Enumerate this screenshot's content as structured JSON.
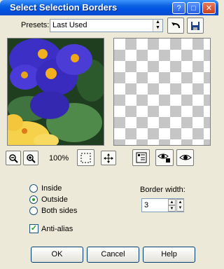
{
  "window": {
    "title": "Select Selection Borders"
  },
  "titlebar": {
    "help_glyph": "?",
    "maximize_glyph": "□",
    "close_glyph": "✕"
  },
  "presets": {
    "label": "Presets:",
    "value": "Last Used"
  },
  "zoom": {
    "level": "100%"
  },
  "options": {
    "inside": "Inside",
    "outside": "Outside",
    "both": "Both sides",
    "selected": "outside",
    "anti_alias": "Anti-alias",
    "anti_alias_checked": true
  },
  "border": {
    "label": "Border width:",
    "value": "3"
  },
  "buttons": {
    "ok": "OK",
    "cancel": "Cancel",
    "help": "Help"
  },
  "colors": {
    "titlebar": "#0054e3",
    "face": "#ece9d8",
    "radio_dot": "#21a121"
  }
}
